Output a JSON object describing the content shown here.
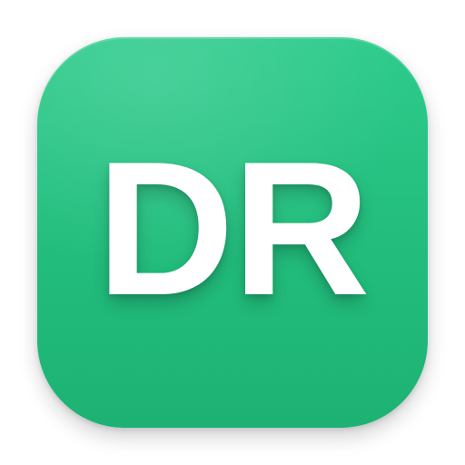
{
  "icon": {
    "monogram": "DR",
    "colors": {
      "background_top": "#2dcb8c",
      "background_bottom": "#1db274",
      "text": "#ffffff"
    }
  }
}
